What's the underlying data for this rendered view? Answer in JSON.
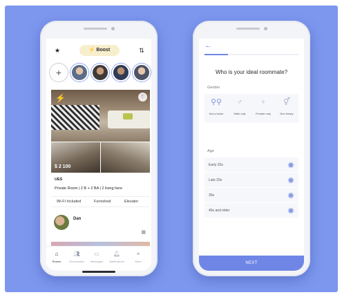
{
  "left_phone": {
    "header": {
      "boost_label": "Boost"
    },
    "listing": {
      "price": "$ 2 100",
      "location": "UES",
      "details": "Private Room | 2 B + 2 BA | 2 living here",
      "amenities": [
        "Wi-Fi Included",
        "Furnished",
        "Elevator"
      ],
      "host_name": "Dan"
    },
    "tabs": [
      {
        "label": "Rooms",
        "icon": "home-icon",
        "active": true
      },
      {
        "label": "Roommates",
        "icon": "people-icon",
        "active": false
      },
      {
        "label": "Messages",
        "icon": "chat-icon",
        "active": false
      },
      {
        "label": "Notifications",
        "icon": "bell-icon",
        "active": false
      },
      {
        "label": "More",
        "icon": "menu-icon",
        "active": false
      }
    ]
  },
  "right_phone": {
    "question": "Who is your ideal roommate?",
    "progress": 0.25,
    "gender_label": "Gender",
    "gender_options": [
      {
        "label": "Not a factor",
        "icon": "group-icon"
      },
      {
        "label": "Male only",
        "icon": "male-icon"
      },
      {
        "label": "Female only",
        "icon": "female-icon"
      },
      {
        "label": "Non binary",
        "icon": "nonbinary-icon"
      }
    ],
    "age_label": "Age",
    "age_options": [
      "Early 20s",
      "Late 20s",
      "30s",
      "40s and older"
    ],
    "next_label": "NEXT"
  },
  "colors": {
    "background": "#7d97ef",
    "accent": "#6f86e6",
    "boost": "#f7eecd"
  }
}
